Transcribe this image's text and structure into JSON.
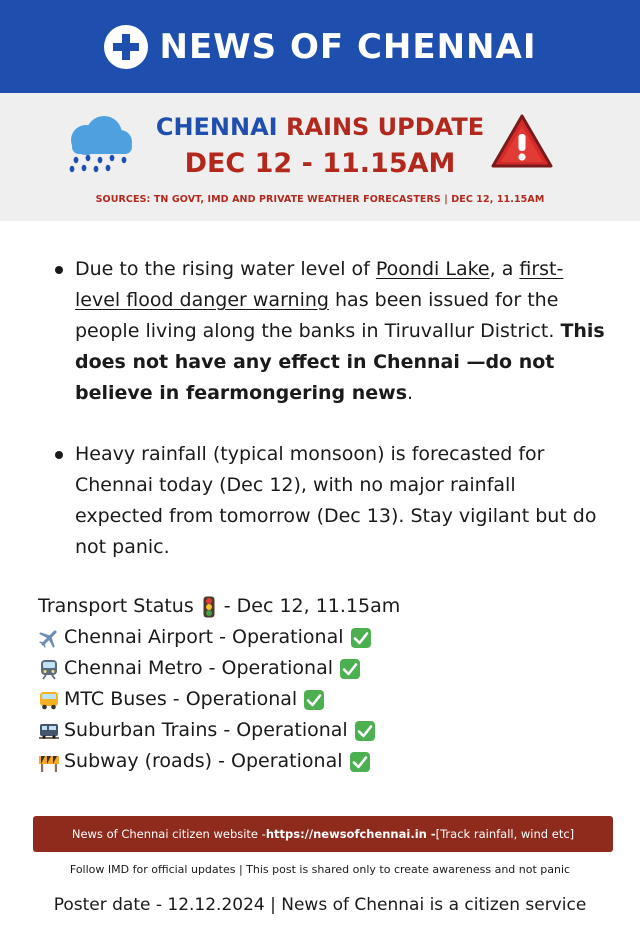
{
  "header": {
    "brand_name": "NEWS OF CHENNAI",
    "brand_color": "#1f4fae"
  },
  "update": {
    "title_part1": "CHENNAI",
    "title_part2": "RAINS UPDATE",
    "date_line": "DEC 12 - 11.15AM",
    "sources": "SOURCES: TN GOVT, IMD AND PRIVATE WEATHER FORECASTERS | DEC 12, 11.15AM",
    "accent_color": "#b2281c",
    "icons": [
      "rain-cloud-icon",
      "warning-triangle-icon"
    ]
  },
  "bulletins": {
    "b1_pre": "Due to the rising water level of ",
    "b1_link1": "Poondi Lake",
    "b1_mid": ", a ",
    "b1_link2": "first-level flood danger warning",
    "b1_post": " has been issued for the people living along the banks in Tiruvallur District. ",
    "b1_bold": "This does not have any effect in Chennai —do not believe in fearmongering news",
    "b1_end": ".",
    "b2": "Heavy rainfall (typical monsoon) is forecasted for Chennai today (Dec 12), with no major rainfall expected from tomorrow (Dec 13). Stay vigilant but do not panic."
  },
  "transport": {
    "heading_label": "Transport Status",
    "heading_date": "- Dec 12, 11.15am",
    "items": [
      {
        "icon": "airplane-icon",
        "label": "Chennai Airport - Operational"
      },
      {
        "icon": "metro-train-icon",
        "label": "Chennai Metro - Operational"
      },
      {
        "icon": "bus-icon",
        "label": "MTC Buses - Operational"
      },
      {
        "icon": "suburban-train-icon",
        "label": "Suburban Trains - Operational"
      },
      {
        "icon": "construction-barrier-icon",
        "label": "Subway (roads) - Operational"
      }
    ],
    "status_icon": "check-mark-icon"
  },
  "footer": {
    "website_prefix": "News of Chennai citizen website - ",
    "website_url": "https://newsofchennai.in -",
    "website_suffix": " [Track rainfall, wind etc]",
    "follow_text": "Follow IMD for official updates | This post is shared only to create awareness and not panic",
    "poster_text": "Poster date - 12.12.2024 | News of Chennai is a citizen service"
  }
}
